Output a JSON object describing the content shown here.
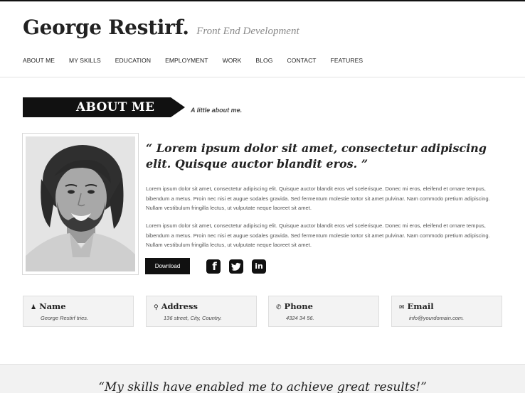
{
  "header": {
    "name": "George Restirf.",
    "tagline": "Front End Development"
  },
  "nav": {
    "items": [
      "ABOUT ME",
      "MY SKILLS",
      "EDUCATION",
      "EMPLOYMENT",
      "WORK",
      "BLOG",
      "CONTACT",
      "FEATURES"
    ]
  },
  "about": {
    "heading": "ABOUT ME",
    "subheading": "A little about me.",
    "quote": "“ Lorem ipsum dolor sit amet, consectetur adipiscing elit. Quisque auctor blandit eros. ”",
    "paragraph1": "Lorem ipsum dolor sit amet, consectetur adipiscing elit. Quisque auctor blandit eros vel scelerisque. Donec mi eros, eleifend et ornare tempus, bibendum a metus. Proin nec nisi et augue sodales gravida. Sed fermentum molestie tortor sit amet pulvinar. Nam commodo pretium adipiscing. Nullam vestibulum fringilla lectus, ut vulputate neque laoreet sit amet.",
    "paragraph2": "Lorem ipsum dolor sit amet, consectetur adipiscing elit. Quisque auctor blandit eros vel scelerisque. Donec mi eros, eleifend et ornare tempus, bibendum a metus. Proin nec nisi et augue sodales gravida. Sed fermentum molestie tortor sit amet pulvinar. Nam commodo pretium adipiscing. Nullam vestibulum fringilla lectus, ut vulputate neque laoreet sit amet.",
    "download_label": "Download",
    "social": [
      "facebook-icon",
      "twitter-icon",
      "linkedin-icon"
    ]
  },
  "info": {
    "name_title": "Name",
    "name_value": "George Restirf tries.",
    "address_title": "Address",
    "address_value": "136 street, City, Country.",
    "phone_title": "Phone",
    "phone_value": "4324 34 56.",
    "email_title": "Email",
    "email_value": "info@yourdomain.com."
  },
  "skills": {
    "quote": "“My skills have enabled me to achieve great results!”"
  }
}
